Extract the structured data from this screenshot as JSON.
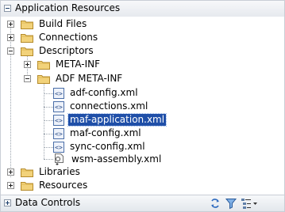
{
  "header": {
    "title": "Application Resources",
    "toggle_icon": "collapse-minus"
  },
  "tree": {
    "build_files": "Build Files",
    "connections": "Connections",
    "descriptors": "Descriptors",
    "meta_inf": "META-INF",
    "adf_meta_inf": "ADF META-INF",
    "files": [
      {
        "label": "adf-config.xml",
        "icon": "xml-file-icon"
      },
      {
        "label": "connections.xml",
        "icon": "xml-file-icon"
      },
      {
        "label": "maf-application.xml",
        "icon": "xml-file-icon",
        "selected": true
      },
      {
        "label": "maf-config.xml",
        "icon": "xml-file-icon"
      },
      {
        "label": "sync-config.xml",
        "icon": "xml-file-icon"
      },
      {
        "label": "wsm-assembly.xml",
        "icon": "wsm-file-icon"
      }
    ],
    "libraries": "Libraries",
    "resources": "Resources"
  },
  "footer": {
    "title": "Data Controls",
    "tools": [
      "refresh-icon",
      "filter-icon",
      "view-options-icon"
    ]
  },
  "colors": {
    "selection": "#1f4fa8",
    "folder": "#f2d27a",
    "header_bg": "#eceff3"
  }
}
